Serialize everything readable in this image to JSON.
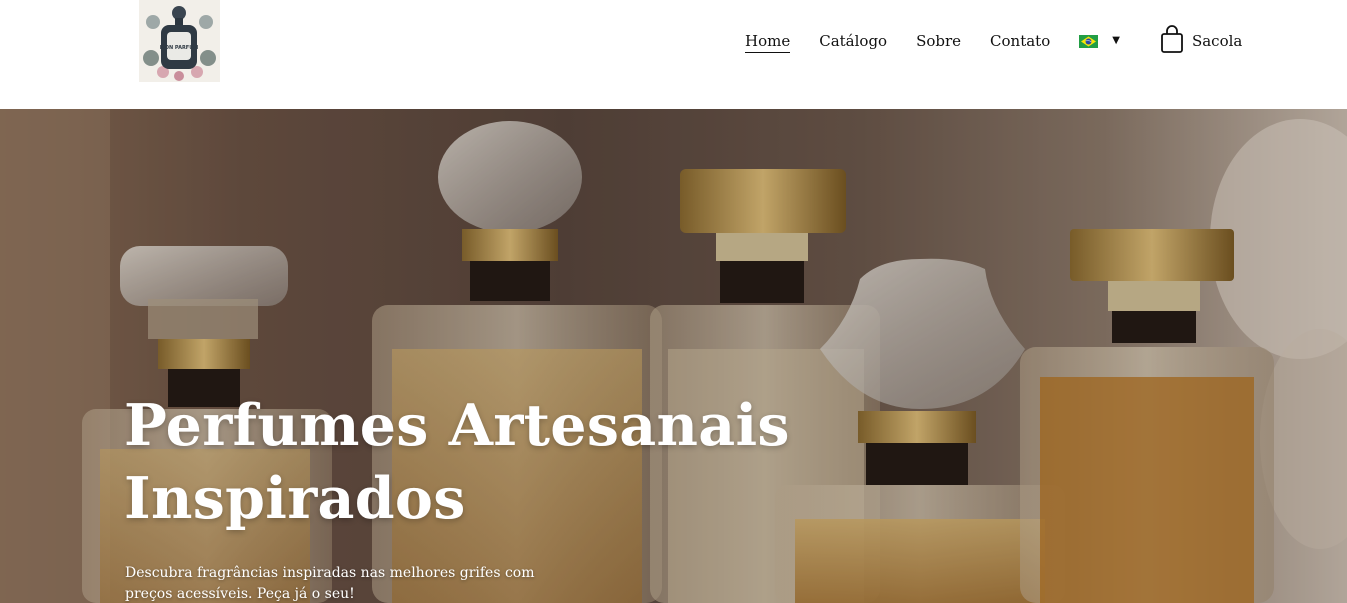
{
  "header": {
    "logo": {
      "alt_text": "MON PARFUM"
    },
    "nav": [
      {
        "label": "Home",
        "active": true
      },
      {
        "label": "Catálogo",
        "active": false
      },
      {
        "label": "Sobre",
        "active": false
      },
      {
        "label": "Contato",
        "active": false
      }
    ],
    "language": {
      "icon": "brazil-flag-icon",
      "caret_icon": "caret-down-icon"
    },
    "cart": {
      "icon": "shopping-bag-icon",
      "label": "Sacola"
    }
  },
  "hero": {
    "title_line1": "Perfumes Artesanais",
    "title_line2": "Inspirados",
    "subtitle": "Descubra fragrâncias inspiradas nas melhores grifes com preços acessíveis. Peça já o seu!"
  },
  "colors": {
    "text": "#111111",
    "hero_text": "#ffffff",
    "gold": "#c9a24a"
  }
}
